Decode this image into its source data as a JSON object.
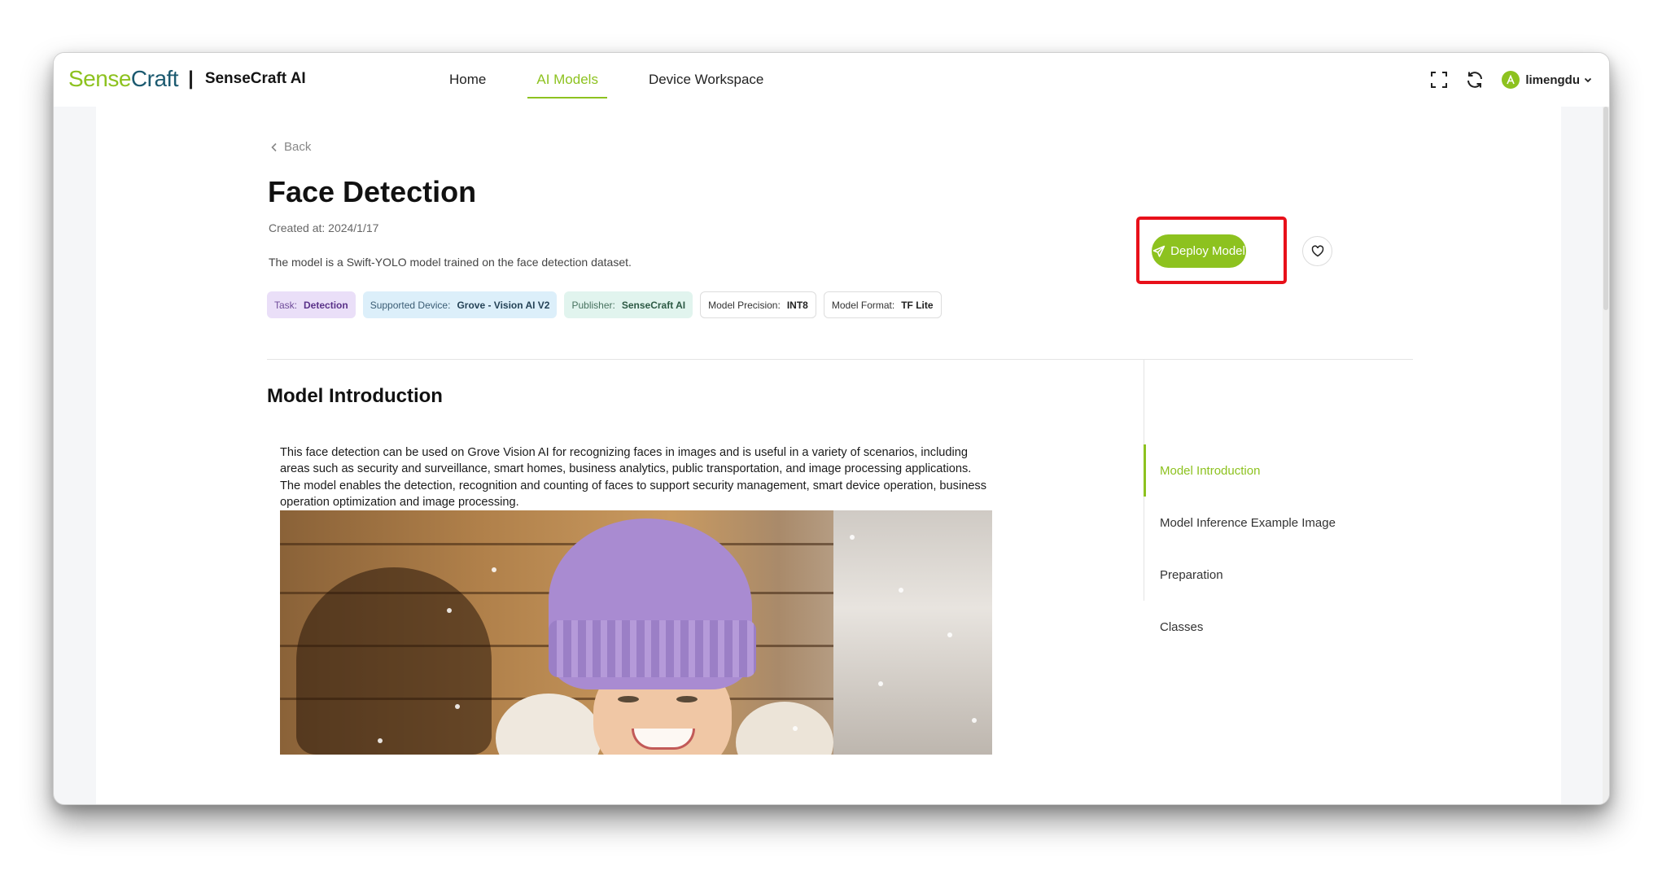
{
  "header": {
    "logo_sense": "Sense",
    "logo_craft": "Craft",
    "logo_separator": "|",
    "app_name": "SenseCraft AI",
    "nav": [
      {
        "label": "Home",
        "active": false
      },
      {
        "label": "AI Models",
        "active": true
      },
      {
        "label": "Device Workspace",
        "active": false
      }
    ],
    "icons": [
      "fullscreen-icon",
      "refresh-icon"
    ],
    "user": {
      "avatar_letter": "A",
      "name": "limengdu"
    }
  },
  "page": {
    "back_label": "Back",
    "title": "Face Detection",
    "created": "Created at: 2024/1/17",
    "description": "The model is a Swift-YOLO model trained on the face detection dataset.",
    "tags": [
      {
        "label": "Task:",
        "value": "Detection"
      },
      {
        "label": "Supported Device:",
        "value": "Grove - Vision AI V2"
      },
      {
        "label": "Publisher:",
        "value": "SenseCraft AI"
      },
      {
        "label": "Model Precision:",
        "value": "INT8"
      },
      {
        "label": "Model Format:",
        "value": "TF Lite"
      }
    ],
    "deploy_label": "Deploy Model",
    "section_title": "Model Introduction",
    "intro_text": "This face detection can be used on Grove Vision AI for recognizing faces in images and is useful in a variety of scenarios, including areas such as security and surveillance, smart homes, business analytics, public transportation, and image processing applications. The model enables the detection, recognition and counting of faces to support security management, smart device operation, business operation optimization and image processing.",
    "toc": [
      {
        "label": "Model Introduction",
        "active": true
      },
      {
        "label": "Model Inference Example Image",
        "active": false
      },
      {
        "label": "Preparation",
        "active": false
      },
      {
        "label": "Classes",
        "active": false
      }
    ]
  },
  "colors": {
    "accent": "#8dc21f",
    "logo_dark": "#1c5a70",
    "highlight_frame": "#e8101a"
  }
}
